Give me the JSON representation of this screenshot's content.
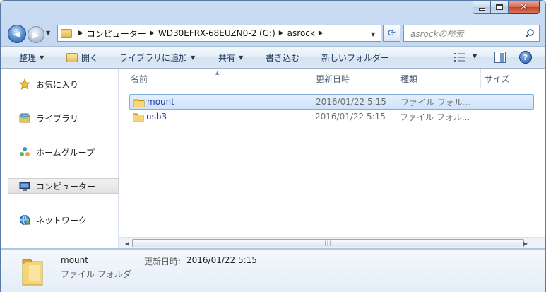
{
  "address": {
    "crumbs": [
      "コンピューター",
      "WD30EFRX-68EUZN0-2 (G:)",
      "asrock"
    ]
  },
  "search": {
    "placeholder": "asrockの検索"
  },
  "toolbar": {
    "organize": "整理",
    "open": "開く",
    "include_in_library": "ライブラリに追加",
    "share": "共有",
    "burn": "書き込む",
    "new_folder": "新しいフォルダー"
  },
  "navpane": {
    "items": [
      {
        "label": "お気に入り",
        "icon": "star-icon"
      },
      {
        "label": "ライブラリ",
        "icon": "library-icon"
      },
      {
        "label": "ホームグループ",
        "icon": "homegroup-icon"
      },
      {
        "label": "コンピューター",
        "icon": "computer-icon",
        "selected": true
      },
      {
        "label": "ネットワーク",
        "icon": "network-icon"
      }
    ]
  },
  "filelist": {
    "columns": [
      "名前",
      "更新日時",
      "種類",
      "サイズ"
    ],
    "rows": [
      {
        "name": "mount",
        "date": "2016/01/22 5:15",
        "type": "ファイル フォル...",
        "selected": true
      },
      {
        "name": "usb3",
        "date": "2016/01/22 5:15",
        "type": "ファイル フォル..."
      }
    ]
  },
  "details": {
    "name": "mount",
    "type": "ファイル フォルダー",
    "date_label": "更新日時:",
    "date": "2016/01/22 5:15"
  },
  "colors": {
    "accent": "#1e3da0",
    "selection": "#cee3fb",
    "frame": "#b6cde9"
  }
}
